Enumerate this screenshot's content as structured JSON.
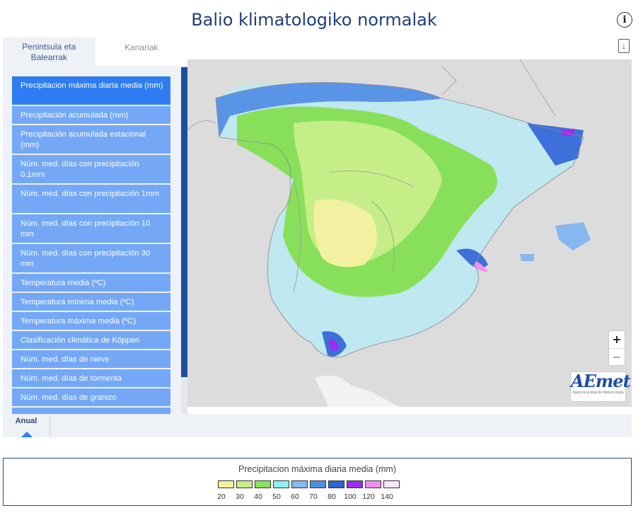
{
  "header": {
    "title": "Balio klimatologiko normalak",
    "info_icon": "i",
    "download_icon": "↓"
  },
  "tabs": [
    {
      "label": "Penintsula eta Balearrak"
    },
    {
      "label": "Kanariak"
    }
  ],
  "menu": [
    {
      "label": "Precipitacion máxima diaria media (mm)"
    },
    {
      "label": "Precipitación acumulada (mm)"
    },
    {
      "label": "Precipitación acumulada estacional (mm)"
    },
    {
      "label": "Núm. med. días con precipitación 0.1mm"
    },
    {
      "label": "Núm. med. días con precipitación 1mm"
    },
    {
      "label": "Núm. med. días con precipitación 10 mm"
    },
    {
      "label": "Núm. med. días con precipitación 30 mm"
    },
    {
      "label": "Temperatura media (ºC)"
    },
    {
      "label": "Temperatura mínima media (ºC)"
    },
    {
      "label": "Temperatura máxima media (ºC)"
    },
    {
      "label": "Clasificación climática de Köppen"
    },
    {
      "label": "Núm. med. días de nieve"
    },
    {
      "label": "Núm. med. días de tormenta"
    },
    {
      "label": "Núm. med. días de granizo"
    }
  ],
  "map": {
    "zoom_in": "+",
    "zoom_out": "−",
    "logo_main": "AEmet",
    "logo_sub": "Agencia Estatal de Meteorología"
  },
  "period": {
    "label": "Anual"
  },
  "legend": {
    "title": "Precipitacion máxima diaria media (mm)",
    "labels": [
      "20",
      "30",
      "40",
      "50",
      "60",
      "70",
      "80",
      "100",
      "120",
      "140"
    ],
    "colors": [
      "#f4f39a",
      "#c8ee88",
      "#86e35c",
      "#8ff1f1",
      "#86b7ee",
      "#4f8fe3",
      "#2d64cf",
      "#9b2bee",
      "#ee8ef2",
      "#fbe6fb"
    ]
  }
}
